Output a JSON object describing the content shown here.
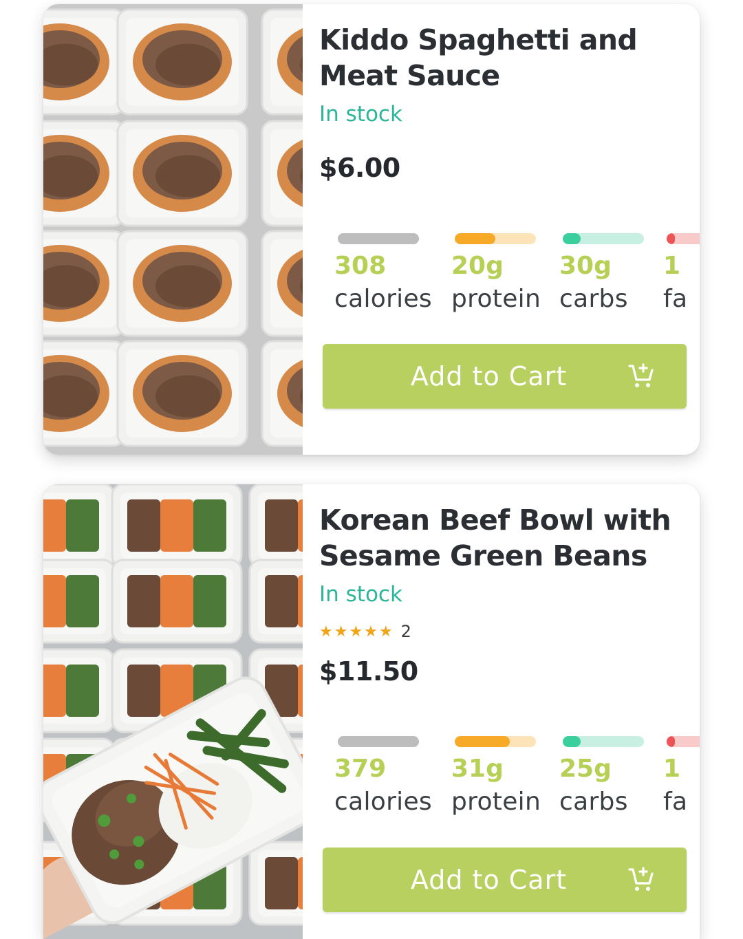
{
  "products": [
    {
      "title": "Kiddo Spaghetti and Meat Sauce",
      "stock": "In stock",
      "rating": null,
      "price": "$6.00",
      "macros": [
        {
          "value": "308",
          "label": "calories",
          "fill": 1.0,
          "color": "#bdbdbd",
          "track": "#bdbdbd"
        },
        {
          "value": "20g",
          "label": "protein",
          "fill": 0.5,
          "color": "#f7a928",
          "track": "#fde4b8"
        },
        {
          "value": "30g",
          "label": "carbs",
          "fill": 0.22,
          "color": "#3ccf9e",
          "track": "#c8f0e2"
        },
        {
          "value": "1",
          "label": "fa",
          "fill": 0.1,
          "color": "#ec5456",
          "track": "#f9caca"
        }
      ],
      "cart_label": "Add to Cart"
    },
    {
      "title": "Korean Beef Bowl with Sesame Green Beans",
      "stock": "In stock",
      "rating": {
        "stars": "★★★★★",
        "count": "2"
      },
      "price": "$11.50",
      "macros": [
        {
          "value": "379",
          "label": "calories",
          "fill": 1.0,
          "color": "#bdbdbd",
          "track": "#bdbdbd"
        },
        {
          "value": "31g",
          "label": "protein",
          "fill": 0.68,
          "color": "#f7a928",
          "track": "#fde4b8"
        },
        {
          "value": "25g",
          "label": "carbs",
          "fill": 0.22,
          "color": "#3ccf9e",
          "track": "#c8f0e2"
        },
        {
          "value": "1",
          "label": "fa",
          "fill": 0.1,
          "color": "#ec5456",
          "track": "#f9caca"
        }
      ],
      "cart_label": "Add to Cart"
    }
  ],
  "colors": {
    "accent_green": "#b8d060",
    "stock_teal": "#2db59a",
    "star_orange": "#f0a41a"
  },
  "icons": {
    "cart": "add-to-cart-icon"
  }
}
